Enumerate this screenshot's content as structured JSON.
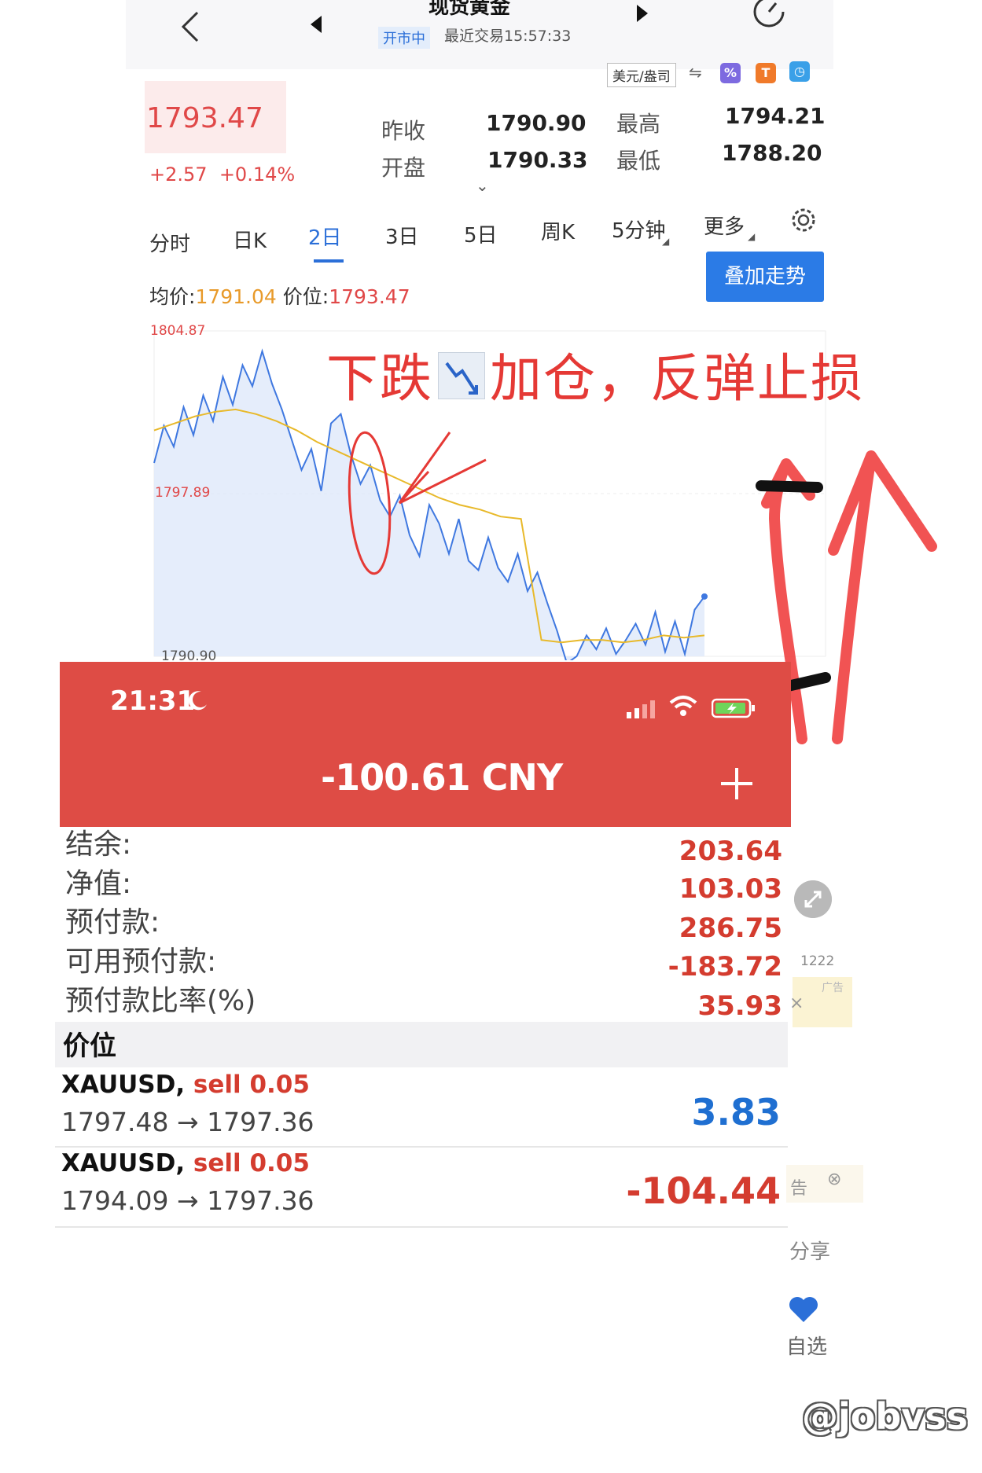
{
  "header": {
    "title": "现货黄金",
    "market_status": "开市中",
    "last_trade": "最近交易15:57:33",
    "currency": "美元/盎司"
  },
  "quote": {
    "price": "1793.47",
    "change": "+2.57",
    "change_pct": "+0.14%",
    "prev_close_label": "昨收",
    "prev_close": "1790.90",
    "open_label": "开盘",
    "open": "1790.33",
    "high_label": "最高",
    "high": "1794.21",
    "low_label": "最低",
    "low": "1788.20"
  },
  "tabs": [
    "分时",
    "日K",
    "2日",
    "3日",
    "5日",
    "周K",
    "5分钟",
    "更多"
  ],
  "active_tab": "2日",
  "overlay_button": "叠加走势",
  "chart_info": {
    "avg_label": "均价:",
    "avg": "1791.04",
    "price_label": "价位:",
    "price": "1793.47"
  },
  "chart_data": {
    "type": "line",
    "title": "",
    "xlabel": "",
    "ylabel": "",
    "ylim": [
      1790.9,
      1804.87
    ],
    "y_ticks": [
      "1804.87",
      "1797.89",
      "1790.90"
    ],
    "series": [
      {
        "values": [
          1799.2,
          1800.8,
          1799.9,
          1801.6,
          1800.4,
          1802.1,
          1801.0,
          1802.9,
          1801.7,
          1803.4,
          1802.5,
          1804.0,
          1802.6,
          1801.5,
          1800.2,
          1798.9,
          1799.8,
          1798.0,
          1800.9,
          1801.3,
          1799.6,
          1798.3,
          1799.1,
          1797.6,
          1796.9,
          1797.8,
          1796.1,
          1795.2,
          1797.4,
          1796.6,
          1795.3,
          1796.8,
          1795.0,
          1794.6,
          1796.0,
          1794.7,
          1794.1,
          1795.3,
          1793.7,
          1794.5,
          1793.2,
          1792.0,
          1790.6,
          1790.9,
          1791.8,
          1791.2,
          1792.1,
          1791.0,
          1791.6,
          1792.3,
          1791.4,
          1792.8,
          1791.1,
          1792.4,
          1791.0,
          1792.9,
          1793.47
        ]
      },
      {
        "values": [
          1800.6,
          1800.9,
          1801.2,
          1801.4,
          1801.5,
          1801.3,
          1801.0,
          1800.6,
          1800.1,
          1799.7,
          1799.3,
          1798.9,
          1798.5,
          1798.1,
          1797.7,
          1797.4,
          1797.2,
          1796.9,
          1796.8,
          1791.6,
          1791.5,
          1791.6,
          1791.6,
          1791.5,
          1791.6,
          1791.8,
          1791.7,
          1791.8
        ]
      }
    ]
  },
  "annotation": {
    "left": "下跌",
    "right": "加仓，反弹止损"
  },
  "trade": {
    "time": "21:31",
    "pnl": "-100.61 CNY",
    "account": [
      {
        "label": "结余:",
        "value": "203.64"
      },
      {
        "label": "净值:",
        "value": "103.03"
      },
      {
        "label": "预付款:",
        "value": "286.75"
      },
      {
        "label": "可用预付款:",
        "value": "-183.72"
      },
      {
        "label": "预付款比率(%)",
        "value": "35.93"
      }
    ],
    "positions_title": "价位",
    "positions": [
      {
        "symbol": "XAUUSD,",
        "side": "sell 0.05",
        "prices": "1797.48 → 1797.36",
        "profit": "3.83",
        "profit_color": "#1f6fd1"
      },
      {
        "symbol": "XAUUSD,",
        "side": "sell 0.05",
        "prices": "1794.09 → 1797.36",
        "profit": "-104.44",
        "profit_color": "#d43c2f"
      }
    ]
  },
  "side_panel": {
    "views": "1222",
    "ad": "广告",
    "ad2": "告",
    "share": "分享",
    "fav": "自选"
  },
  "watermark": "@jobvss",
  "colors": {
    "up_red": "#e04848",
    "accent_blue": "#2b6fd8",
    "banner_red": "#de4c45",
    "avg_orange": "#e8b92a"
  }
}
